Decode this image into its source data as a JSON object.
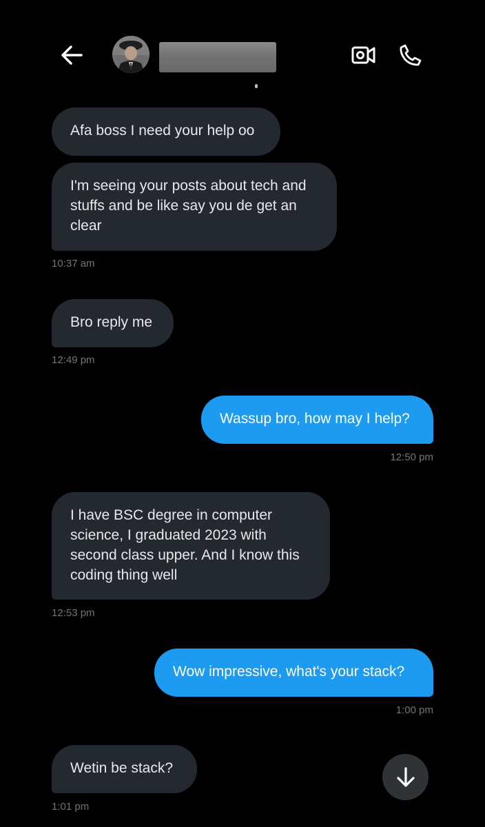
{
  "header": {
    "back_icon": "arrow-left-icon",
    "avatar_icon": "profile-avatar",
    "name_redacted": "",
    "video_icon": "video-camera-icon",
    "call_icon": "phone-icon"
  },
  "messages": [
    {
      "direction": "in",
      "text": "Afa boss I need your help oo"
    },
    {
      "direction": "in",
      "text": "I'm seeing your posts about tech and stuffs and be like say you de get an clear",
      "time": "10:37 am"
    },
    {
      "direction": "in",
      "text": "Bro reply me",
      "time": "12:49 pm"
    },
    {
      "direction": "out",
      "text": "Wassup bro, how may I help?",
      "time": "12:50 pm"
    },
    {
      "direction": "in",
      "text": "I have BSC degree in computer science, I graduated 2023 with second class upper. And I know this coding thing well",
      "time": "12:53 pm"
    },
    {
      "direction": "out",
      "text": "Wow impressive, what's your stack?",
      "time": "1:00 pm"
    },
    {
      "direction": "in",
      "text": "Wetin be stack?",
      "time": "1:01 pm"
    }
  ],
  "scroll_down_icon": "arrow-down-icon",
  "colors": {
    "background": "#000000",
    "incoming_bubble": "#23292f",
    "outgoing_bubble": "#1d9bf0",
    "timestamp": "#71767b",
    "text": "#e7e9ea"
  }
}
